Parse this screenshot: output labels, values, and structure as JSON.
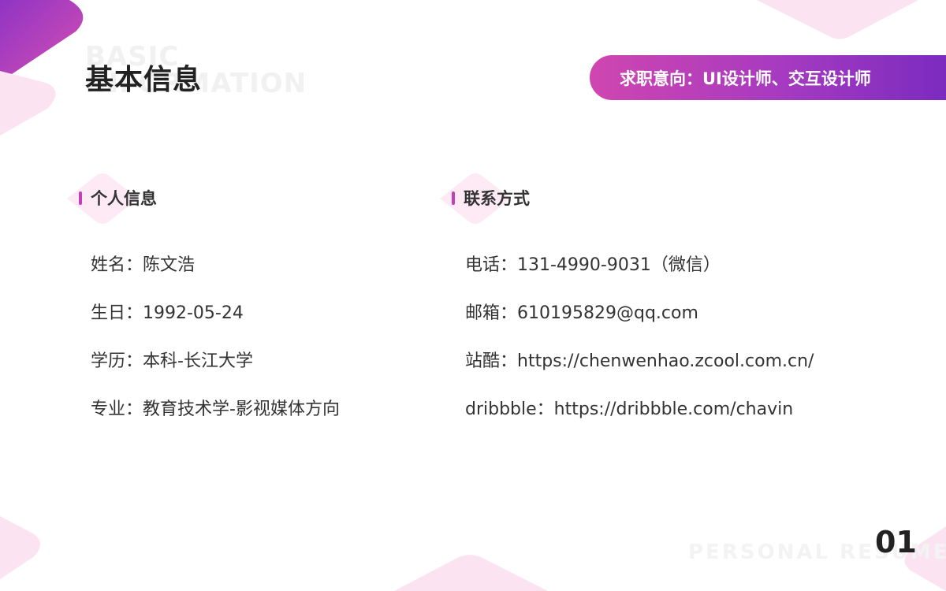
{
  "header": {
    "bg_text": "BASIC\nINFORMATION",
    "title": "基本信息",
    "intent": "求职意向：UI设计师、交互设计师"
  },
  "personal": {
    "title": "个人信息",
    "fields": [
      "姓名：陈文浩",
      "生日：1992-05-24",
      "学历：本科-长江大学",
      "专业：教育技术学-影视媒体方向"
    ]
  },
  "contact": {
    "title": "联系方式",
    "fields": [
      "电话：131-4990-9031（微信）",
      "邮箱：610195829@qq.com",
      "站酷：https://chenwenhao.zcool.com.cn/",
      "dribbble：https://dribbble.com/chavin"
    ]
  },
  "footer": {
    "text": "PERSONAL RESUME",
    "page_number": "01"
  },
  "colors": {
    "accent_pink": "#cf46b0",
    "accent_purple": "#7b2bbf",
    "light_pink": "#fbe3f1"
  }
}
